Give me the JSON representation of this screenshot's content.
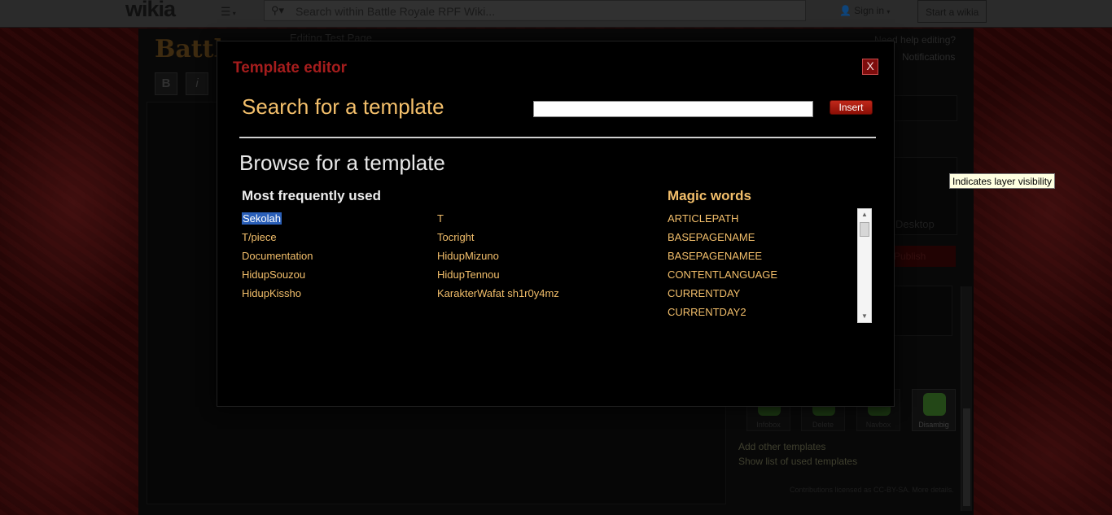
{
  "global_nav": {
    "logo": "wikia",
    "search_placeholder": "Search within Battle Royale RPF Wiki...",
    "sign_in_label": "Sign in",
    "start_wikia_label": "Start a wikia"
  },
  "background_page": {
    "wiki_logo": "Battle",
    "editing_label": "Editing Test Page",
    "bold_label": "B",
    "italic_label": "i",
    "help_label": "Need help editing?",
    "notifications_label": "Notifications",
    "desktop_label": "Desktop",
    "publish_label": "Publish",
    "template_tiles": [
      "Infobox",
      "Delete",
      "Navbox",
      "Disambig"
    ],
    "add_templates_label": "Add other templates",
    "show_used_label": "Show list of used templates",
    "license_text": "Contributions licensed as CC-BY-SA. More details."
  },
  "modal": {
    "title": "Template editor",
    "close_label": "X",
    "search_heading": "Search for a template",
    "search_value": "",
    "insert_label": "Insert",
    "browse_heading": "Browse for a template",
    "most_used_heading": "Most frequently used",
    "magic_heading": "Magic words",
    "most_used_col1": [
      "Sekolah",
      "T/piece",
      "Documentation",
      "HidupSouzou",
      "HidupKissho"
    ],
    "most_used_col2": [
      "T",
      "Tocright",
      "HidupMizuno",
      "HidupTennou",
      "KarakterWafat sh1r0y4mz"
    ],
    "selected_template": "Sekolah",
    "magic_words": [
      "ARTICLEPATH",
      "BASEPAGENAME",
      "BASEPAGENAMEE",
      "CONTENTLANGUAGE",
      "CURRENTDAY",
      "CURRENTDAY2"
    ]
  },
  "tooltip": "Indicates layer visibility",
  "colors": {
    "title_red": "#a51d1d",
    "accent_gold": "#f3bf6b",
    "insert_red": "#c0281a",
    "selection_blue": "#2a5fb8"
  }
}
